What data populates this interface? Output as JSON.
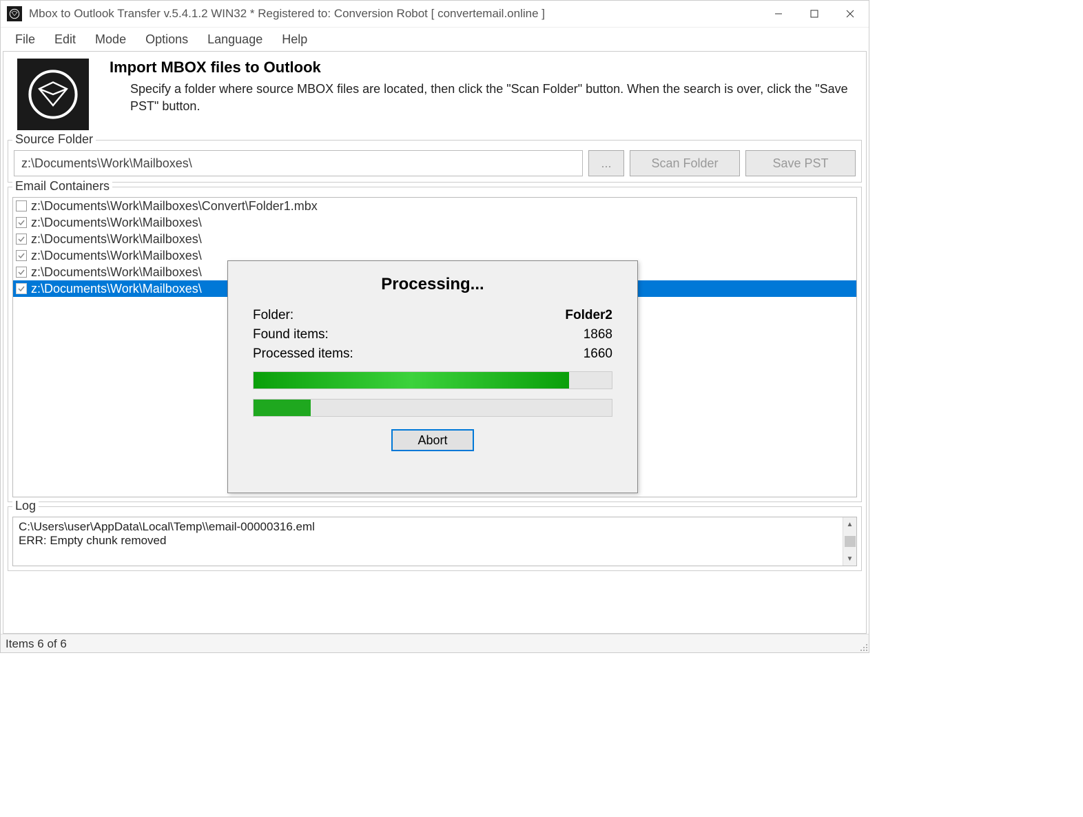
{
  "window": {
    "title": "Mbox to Outlook Transfer v.5.4.1.2 WIN32 * Registered to: Conversion Robot [ convertemail.online ]"
  },
  "menu": {
    "items": [
      "File",
      "Edit",
      "Mode",
      "Options",
      "Language",
      "Help"
    ]
  },
  "header": {
    "title": "Import MBOX files to Outlook",
    "description": "Specify a folder where source MBOX files are located, then click the \"Scan Folder\" button. When the search is over, click the \"Save PST\" button."
  },
  "source": {
    "legend": "Source Folder",
    "path": "z:\\Documents\\Work\\Mailboxes\\",
    "browse_label": "...",
    "scan_label": "Scan Folder",
    "save_label": "Save PST"
  },
  "containers": {
    "legend": "Email Containers",
    "items": [
      {
        "checked": false,
        "path": "z:\\Documents\\Work\\Mailboxes\\Convert\\Folder1.mbx",
        "selected": false
      },
      {
        "checked": true,
        "path": "z:\\Documents\\Work\\Mailboxes\\",
        "selected": false
      },
      {
        "checked": true,
        "path": "z:\\Documents\\Work\\Mailboxes\\",
        "selected": false
      },
      {
        "checked": true,
        "path": "z:\\Documents\\Work\\Mailboxes\\",
        "selected": false
      },
      {
        "checked": true,
        "path": "z:\\Documents\\Work\\Mailboxes\\",
        "selected": false
      },
      {
        "checked": true,
        "path": "z:\\Documents\\Work\\Mailboxes\\",
        "selected": true
      }
    ]
  },
  "log": {
    "legend": "Log",
    "lines": [
      "C:\\Users\\user\\AppData\\Local\\Temp\\\\email-00000316.eml",
      "ERR: Empty chunk removed"
    ]
  },
  "status": {
    "text": "Items 6 of 6"
  },
  "dialog": {
    "title": "Processing...",
    "folder_label": "Folder:",
    "folder_value": "Folder2",
    "found_label": "Found items:",
    "found_value": "1868",
    "processed_label": "Processed items:",
    "processed_value": "1660",
    "progress1_pct": 88,
    "progress2_pct": 16,
    "abort_label": "Abort"
  }
}
